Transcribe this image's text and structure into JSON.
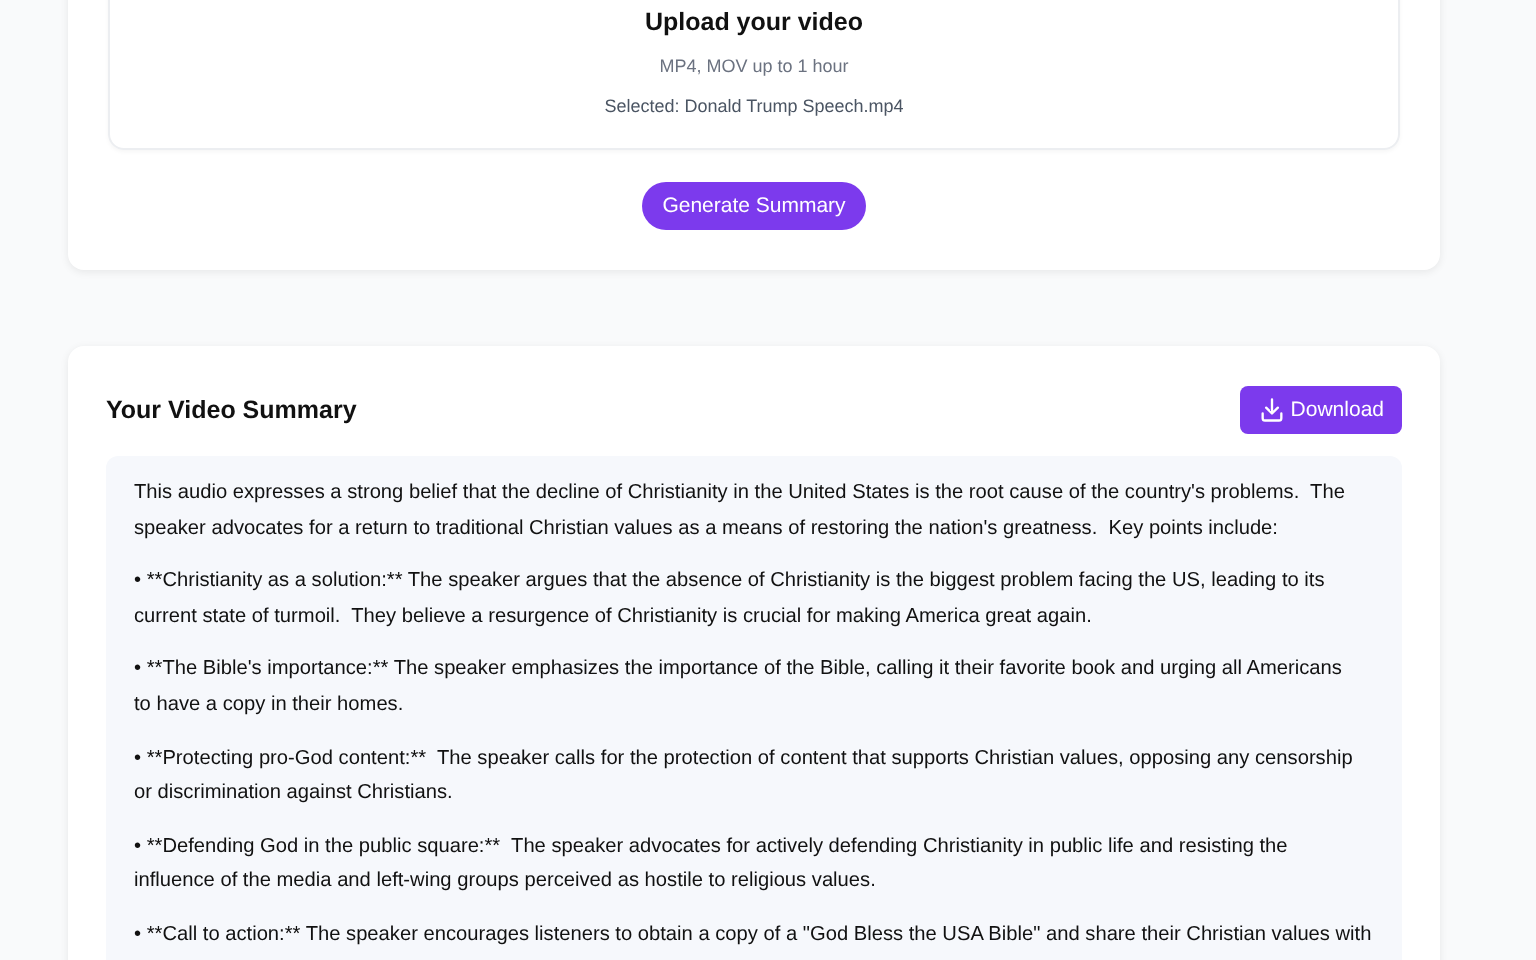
{
  "upload": {
    "title": "Upload your video",
    "hint": "MP4, MOV up to 1 hour",
    "selected_file": "Selected: Donald Trump Speech.mp4",
    "button": "Generate Summary"
  },
  "summary": {
    "title": "Your Video Summary",
    "download_button": "Download",
    "paragraphs": [
      "This audio expresses a strong belief that the decline of Christianity in the United States is the root cause of the country's problems.  The speaker advocates for a return to traditional Christian values as a means of restoring the nation's greatness.  Key points include:",
      "• **Christianity as a solution:** The speaker argues that the absence of Christianity is the biggest problem facing the US, leading to its current state of turmoil.  They believe a resurgence of Christianity is crucial for making America great again.",
      "• **The Bible's importance:** The speaker emphasizes the importance of the Bible, calling it their favorite book and urging all Americans to have a copy in their homes.",
      "• **Protecting pro-God content:**  The speaker calls for the protection of content that supports Christian values, opposing any censorship or discrimination against Christians.",
      "• **Defending God in the public square:**  The speaker advocates for actively defending Christianity in public life and resisting the influence of the media and left-wing groups perceived as hostile to religious values.",
      "• **Call to action:** The speaker encourages listeners to obtain a copy of a \"God Bless the USA Bible\" and share their Christian values with"
    ]
  }
}
